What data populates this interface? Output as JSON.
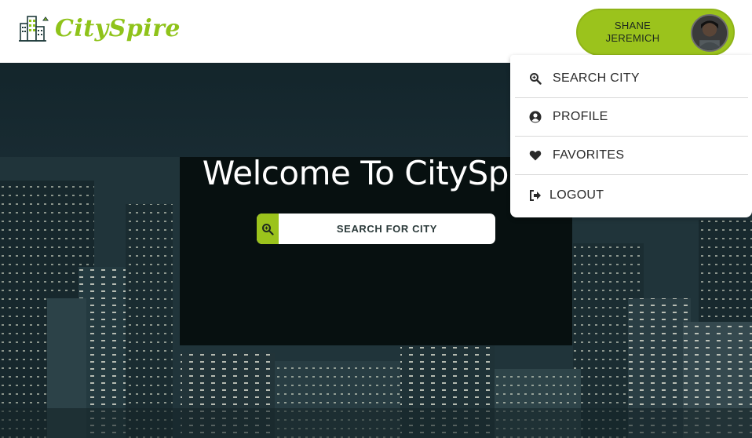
{
  "header": {
    "logo_text": "CitySpire",
    "user_name_line1": "SHANE",
    "user_name_line2": "JEREMICH"
  },
  "hero": {
    "title": "Welcome To CitySpire",
    "search_button_label": "SEARCH FOR CITY"
  },
  "dropdown": {
    "items": [
      {
        "label": "SEARCH CITY",
        "icon": "search-icon"
      },
      {
        "label": "PROFILE",
        "icon": "user-circle-icon"
      },
      {
        "label": "FAVORITES",
        "icon": "heart-icon"
      },
      {
        "label": "LOGOUT",
        "icon": "sign-out-icon"
      }
    ]
  },
  "colors": {
    "accent": "#9bc31c",
    "logo": "#8fc31a",
    "hero_bg": "#1d3038"
  }
}
